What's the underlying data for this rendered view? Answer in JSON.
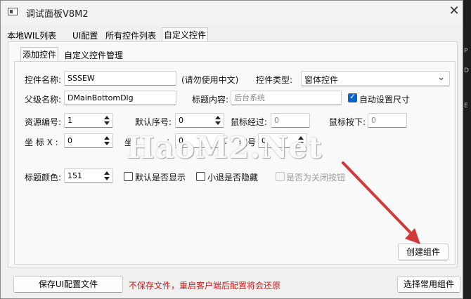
{
  "window": {
    "title": "调试面板V8M2"
  },
  "tabs": [
    "本地WIL列表",
    "UI配置",
    "所有控件列表",
    "自定义控件"
  ],
  "subtabs": [
    "添加控件",
    "自定义控件管理"
  ],
  "form": {
    "control_name_label": "控件名称:",
    "control_name_value": "SSSEW",
    "no_chinese_hint": "(请勿使用中文)",
    "control_type_label": "控件类型:",
    "control_type_value": "窗体控件",
    "parent_name_label": "父级名称:",
    "parent_name_value": "DMainBottomDlg",
    "title_content_label": "标题内容:",
    "title_content_placeholder": "后台系统",
    "auto_size_label": "自动设置尺寸",
    "resource_id_label": "资源编号:",
    "resource_id_value": "1",
    "default_order_label": "默认序号:",
    "default_order_value": "0",
    "mouse_over_label": "鼠标经过:",
    "mouse_over_value": "0",
    "mouse_down_label": "鼠标按下:",
    "mouse_down_value": "0",
    "coord_x_label": "坐 标 X :",
    "coord_x_value": "0",
    "coord_y_label_a": "坐",
    "coord_y_label_b": ":",
    "coord_y_value": "0",
    "edit_no_label_a": "…",
    "edit_no_label_b": "编号",
    "edit_no_value": "0",
    "title_color_label": "标题颜色:",
    "title_color_value": "151",
    "default_show_label": "默认是否显示",
    "minimize_hide_label": "小退是否隐藏",
    "close_button_label": "是否为关闭按钮",
    "create_button": "创建组件"
  },
  "footer": {
    "save_button": "保存UI配置文件",
    "warning": "不保存文件，重启客户端后配置将会还原",
    "select_common_button": "选择常用组件"
  },
  "watermark": "HaoM2.Net",
  "colors": {
    "warning": "#d01818",
    "checkbox": "#0a64c8",
    "arrow": "#d23a3a"
  }
}
